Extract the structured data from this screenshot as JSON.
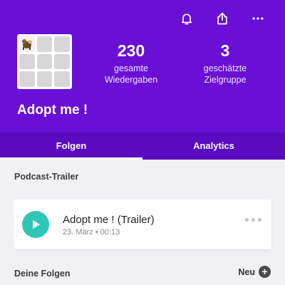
{
  "header": {
    "icons": [
      "bell-icon",
      "share-icon",
      "more-icon"
    ],
    "stats": [
      {
        "value": "230",
        "label_line1": "gesamte",
        "label_line2": "Wiedergaben"
      },
      {
        "value": "3",
        "label_line1": "geschätzte",
        "label_line2": "Zielgruppe"
      }
    ],
    "podcast_title": "Adopt me !"
  },
  "tabs": [
    {
      "label": "Folgen",
      "active": true
    },
    {
      "label": "Analytics",
      "active": false
    }
  ],
  "trailer_section": {
    "label": "Podcast-Trailer",
    "episode": {
      "title": "Adopt me !  (Trailer)",
      "meta": "23. März • 00:13"
    }
  },
  "episodes_section": {
    "label": "Deine Folgen",
    "new_label": "Neu"
  },
  "colors": {
    "header_bg": "#6a0fd6",
    "tabs_bg": "#5a0bc0",
    "play_button": "#2ec7b5",
    "page_bg": "#f1f0f4"
  }
}
